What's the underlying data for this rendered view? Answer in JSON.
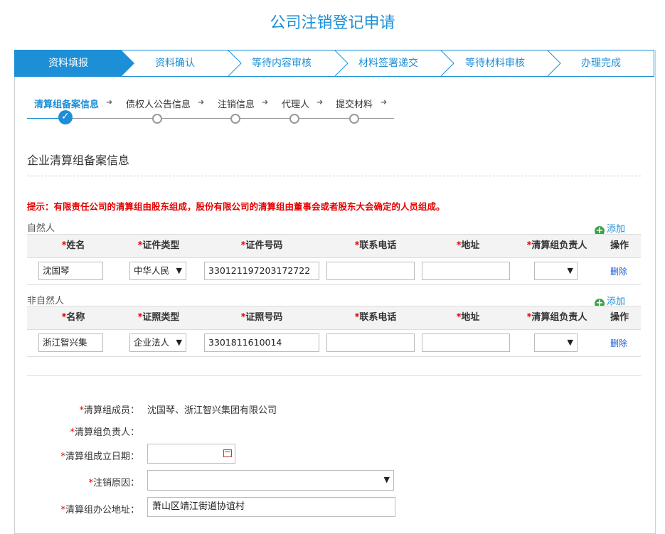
{
  "page": {
    "title": "公司注销登记申请"
  },
  "steps": [
    "资料填报",
    "资料确认",
    "等待内容审核",
    "材料签署递交",
    "等待材料审核",
    "办理完成"
  ],
  "substeps": [
    "清算组备案信息",
    "债权人公告信息",
    "注销信息",
    "代理人",
    "提交材料"
  ],
  "section": {
    "title": "企业清算组备案信息"
  },
  "tip": "提示：有限责任公司的清算组由股东组成，股份有限公司的清算组由董事会或者股东大会确定的人员组成。",
  "natural": {
    "label": "自然人",
    "add": "添加",
    "headers": [
      "姓名",
      "证件类型",
      "证件号码",
      "联系电话",
      "地址",
      "清算组负责人",
      "操作"
    ],
    "row": {
      "name": "沈国琴",
      "id_type": "中华人民",
      "id_number": "330121197203172722",
      "phone": "",
      "address": "",
      "leader": "",
      "action": "删除"
    }
  },
  "legal": {
    "label": "非自然人",
    "add": "添加",
    "headers": [
      "名称",
      "证照类型",
      "证照号码",
      "联系电话",
      "地址",
      "清算组负责人",
      "操作"
    ],
    "row": {
      "name": "浙江智兴集",
      "id_type": "企业法人",
      "id_number": "3301811610014",
      "phone": "",
      "address": "",
      "leader": "",
      "action": "删除"
    }
  },
  "form": {
    "members_label": "清算组成员：",
    "members_value": "沈国琴、浙江智兴集团有限公司",
    "leader_label": "清算组负责人：",
    "date_label": "清算组成立日期：",
    "date_value": "",
    "reason_label": "注销原因：",
    "reason_value": "",
    "office_label": "清算组办公地址：",
    "office_value": "萧山区靖江街道协谊村"
  },
  "colors": {
    "accent": "#1c8fd6",
    "required": "#e60000",
    "add": "#3aa545"
  }
}
